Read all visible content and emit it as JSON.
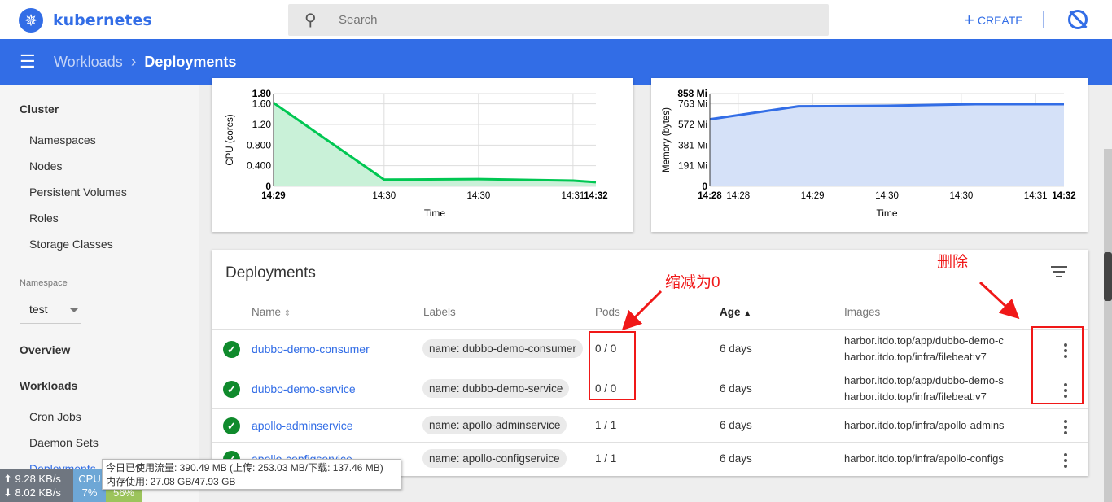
{
  "header": {
    "logo": "kubernetes",
    "search_placeholder": "Search",
    "create_label": "CREATE",
    "icons": {
      "logo": "kubernetes-helm-icon",
      "search": "search-icon",
      "create": "plus-icon",
      "notifications": "notifications-off-icon"
    }
  },
  "breadcrumb": {
    "parent": "Workloads",
    "current": "Deployments"
  },
  "sidebar": {
    "cluster": "Cluster",
    "cluster_items": [
      "Namespaces",
      "Nodes",
      "Persistent Volumes",
      "Roles",
      "Storage Classes"
    ],
    "namespace_label": "Namespace",
    "namespace_value": "test",
    "overview": "Overview",
    "workloads": "Workloads",
    "workload_items": [
      "Cron Jobs",
      "Daemon Sets",
      "Deployments"
    ]
  },
  "charts": {
    "cpu": {
      "type": "area",
      "ylabel": "CPU (cores)",
      "xlabel": "Time",
      "y_ticks": [
        "0",
        "0.400",
        "0.800",
        "1.20",
        "1.60",
        "1.80"
      ],
      "ylim": [
        0,
        1.8
      ],
      "x_ticks": [
        "14:29",
        "14:30",
        "14:30",
        "14:31",
        "14:32"
      ],
      "values": [
        1.62,
        0.13,
        0.14,
        0.11,
        0.08
      ],
      "color": "#00c752"
    },
    "memory": {
      "type": "area",
      "ylabel": "Memory (bytes)",
      "xlabel": "Time",
      "y_ticks": [
        "0",
        "191 Mi",
        "381 Mi",
        "572 Mi",
        "763 Mi",
        "858 Mi"
      ],
      "ylim": [
        0,
        858
      ],
      "x_ticks": [
        "14:28",
        "14:28",
        "14:29",
        "14:30",
        "14:30",
        "14:31",
        "14:32"
      ],
      "values": [
        620,
        740,
        745,
        760,
        760
      ],
      "color": "#326de6"
    }
  },
  "deployments": {
    "title": "Deployments",
    "columns": {
      "name": "Name",
      "labels": "Labels",
      "pods": "Pods",
      "age": "Age",
      "images": "Images"
    },
    "rows": [
      {
        "name": "dubbo-demo-consumer",
        "label": "name: dubbo-demo-consumer",
        "pods": "0 / 0",
        "age": "6 days",
        "images": [
          "harbor.itdo.top/app/dubbo-demo-consumer",
          "harbor.itdo.top/infra/filebeat:v7"
        ]
      },
      {
        "name": "dubbo-demo-service",
        "label": "name: dubbo-demo-service",
        "pods": "0 / 0",
        "age": "6 days",
        "images": [
          "harbor.itdo.top/app/dubbo-demo-service",
          "harbor.itdo.top/infra/filebeat:v7"
        ]
      },
      {
        "name": "apollo-adminservice",
        "label": "name: apollo-adminservice",
        "pods": "1 / 1",
        "age": "6 days",
        "images": [
          "harbor.itdo.top/infra/apollo-adminservice"
        ]
      },
      {
        "name": "apollo-configservice",
        "label": "name: apollo-configservice",
        "pods": "1 / 1",
        "age": "6 days",
        "images": [
          "harbor.itdo.top/infra/apollo-configservice"
        ]
      }
    ]
  },
  "annotations": {
    "scale_to_zero": "缩减为0",
    "delete": "删除",
    "color": "#f01818"
  },
  "netmonitor": {
    "up": "9.28 KB/s",
    "down": "8.02 KB/s",
    "cpu_label": "CPU",
    "cpu": "7%",
    "mem": "56%",
    "tooltip_line1": "今日已使用流量: 390.49 MB (上传: 253.03 MB/下载: 137.46 MB)",
    "tooltip_line2": "内存使用: 27.08 GB/47.93 GB"
  }
}
